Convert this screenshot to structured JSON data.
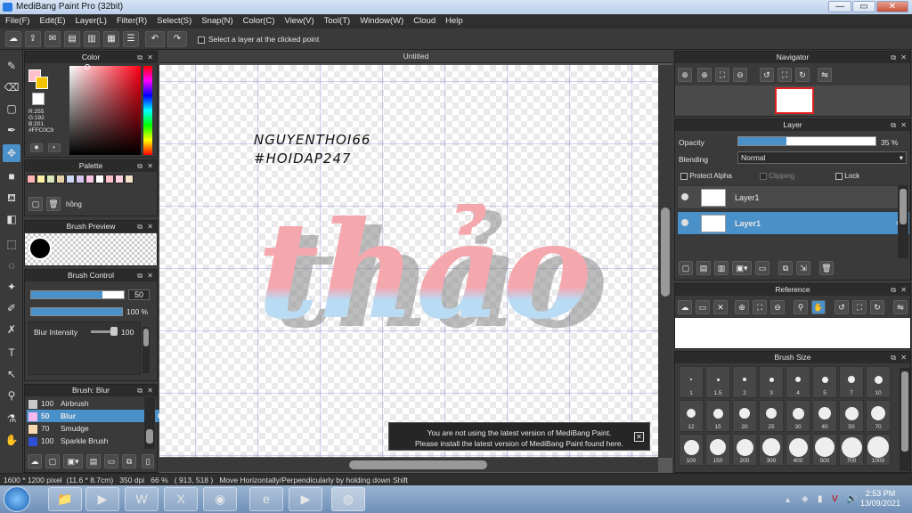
{
  "window": {
    "title": "MediBang Paint Pro (32bit)",
    "minimize": "—",
    "maximize": "▭",
    "close": "✕"
  },
  "menu": [
    "File(F)",
    "Edit(E)",
    "Layer(L)",
    "Filter(R)",
    "Select(S)",
    "Snap(N)",
    "Color(C)",
    "View(V)",
    "Tool(T)",
    "Window(W)",
    "Cloud",
    "Help"
  ],
  "toolbar": {
    "select_layer_label": "Select a layer at the clicked point"
  },
  "color_panel": {
    "title": "Color",
    "r": "R:255",
    "g": "G:192",
    "b": "B:201",
    "hex": "#FFC0C9",
    "fg_color": "#ffc0c9",
    "bg_color": "#f4c400"
  },
  "palette_panel": {
    "title": "Palette",
    "swatch_name": "hồng",
    "swatches": [
      "#ffb3b3",
      "#fff2a8",
      "#d9e8b8",
      "#e4d1a8",
      "#c9d7f5",
      "#d6c4f0",
      "#f7c3e0",
      "#ffffff",
      "#ffc0c9",
      "#ffd0e0",
      "#f2e3c8"
    ]
  },
  "brush_preview": {
    "title": "Brush Preview"
  },
  "brush_control": {
    "title": "Brush Control",
    "size": "50",
    "opacity": "100 %",
    "blur_label": "Blur Intensity",
    "blur_value": "100"
  },
  "brush_list": {
    "title": "Brush: Blur",
    "items": [
      {
        "size": "100",
        "name": "Airbrush",
        "color": "#c9c9c9"
      },
      {
        "size": "50",
        "name": "Blur",
        "color": "#f6b8f1"
      },
      {
        "size": "70",
        "name": "Smudge",
        "color": "#f8d9b0"
      },
      {
        "size": "100",
        "name": "Sparkle Brush",
        "color": "#2e4fd6"
      }
    ]
  },
  "canvas": {
    "tab": "Untitled",
    "text_line1": "NGUYENTHOI66",
    "text_line2": "#HOIDAP247",
    "art_word": "thảo"
  },
  "notice": {
    "line1": "You are not using the latest version of MediBang Paint.",
    "line2": "Please install the latest version of MediBang Paint found here."
  },
  "navigator": {
    "title": "Navigator"
  },
  "layer_panel": {
    "title": "Layer",
    "opacity_label": "Opacity",
    "opacity_value": "35 %",
    "opacity_fraction": 0.35,
    "blending_label": "Blending",
    "blending_value": "Normal",
    "protect_alpha": "Protect Alpha",
    "clipping": "Clipping",
    "lock": "Lock",
    "layers": [
      "Layer1",
      "Layer1"
    ]
  },
  "reference": {
    "title": "Reference"
  },
  "brush_size": {
    "title": "Brush Size",
    "sizes": [
      "1",
      "1.5",
      "2",
      "3",
      "4",
      "5",
      "7",
      "10",
      "12",
      "15",
      "20",
      "25",
      "30",
      "40",
      "50",
      "70",
      "100",
      "150",
      "200",
      "300",
      "400",
      "500",
      "700",
      "1000"
    ]
  },
  "status": {
    "dimensions": "1600 * 1200 pixel",
    "size_cm": "(11.6 * 8.7cm)",
    "dpi": "350 dpi",
    "zoom": "66 %",
    "coords": "( 913, 518 )",
    "hint": "Move Horizontally/Perpendicularly by holding down Shift"
  },
  "taskbar": {
    "time": "2:53 PM",
    "date": "13/09/2021"
  }
}
